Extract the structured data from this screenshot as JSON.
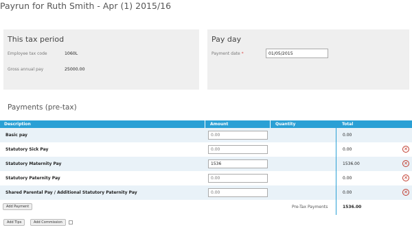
{
  "page": {
    "title": "Payrun for Ruth Smith - Apr (1) 2015/16"
  },
  "tax_period": {
    "title": "This tax period",
    "tax_code_label": "Employee tax code",
    "tax_code_value": "1060L",
    "gross_label": "Gross annual pay",
    "gross_value": "25000.00"
  },
  "pay_day": {
    "title": "Pay day",
    "date_label": "Payment date",
    "required_mark": "*",
    "date_value": "01/05/2015"
  },
  "payments": {
    "title": "Payments (pre-tax)",
    "headers": {
      "description": "Description",
      "amount": "Amount",
      "quantity": "Quantity",
      "total": "Total"
    },
    "rows": [
      {
        "description": "Basic pay",
        "amount": "",
        "amount_placeholder": "0.00",
        "total": "0.00",
        "removable": false
      },
      {
        "description": "Statutory Sick Pay",
        "amount": "",
        "amount_placeholder": "0.00",
        "total": "0.00",
        "removable": true
      },
      {
        "description": "Statutory Maternity Pay",
        "amount": "1536",
        "amount_placeholder": "0.00",
        "total": "1536.00",
        "removable": true
      },
      {
        "description": "Statutory Paternity Pay",
        "amount": "",
        "amount_placeholder": "0.00",
        "total": "0.00",
        "removable": true
      },
      {
        "description": "Shared Parental Pay / Additional Statutory Paternity Pay",
        "amount": "",
        "amount_placeholder": "0.00",
        "total": "0.00",
        "removable": true
      }
    ],
    "add_payment_label": "Add Payment",
    "pretax_label": "Pre-Tax Payments",
    "pretax_total": "1536.00"
  },
  "footer": {
    "add_tips_label": "Add Tips",
    "add_commission_label": "Add Commission"
  },
  "icons": {
    "remove": "remove-circle-icon"
  },
  "colors": {
    "header_bg": "#2aa0d5",
    "alt_row_bg": "#e9f2f8",
    "remove_icon": "#c0392b",
    "panel_bg": "#efefef"
  }
}
